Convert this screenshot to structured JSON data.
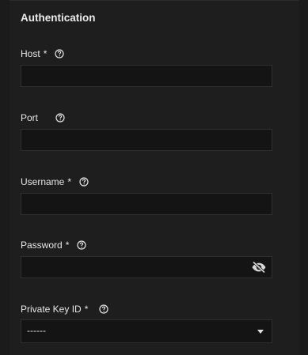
{
  "section": {
    "title": "Authentication"
  },
  "fields": {
    "host": {
      "label": "Host",
      "required": "*",
      "value": ""
    },
    "port": {
      "label": "Port",
      "required": "",
      "value": ""
    },
    "username": {
      "label": "Username",
      "required": "*",
      "value": ""
    },
    "password": {
      "label": "Password",
      "required": "*",
      "value": ""
    },
    "private_key": {
      "label": "Private Key ID",
      "required": "*",
      "selected": "------"
    }
  },
  "icons": {
    "help": "help-circle-icon",
    "password_toggle": "eye-off-icon",
    "dropdown": "caret-down-icon"
  },
  "colors": {
    "background": "#1e1e1e",
    "input_bg": "#141414",
    "text": "#e6e6e6"
  }
}
